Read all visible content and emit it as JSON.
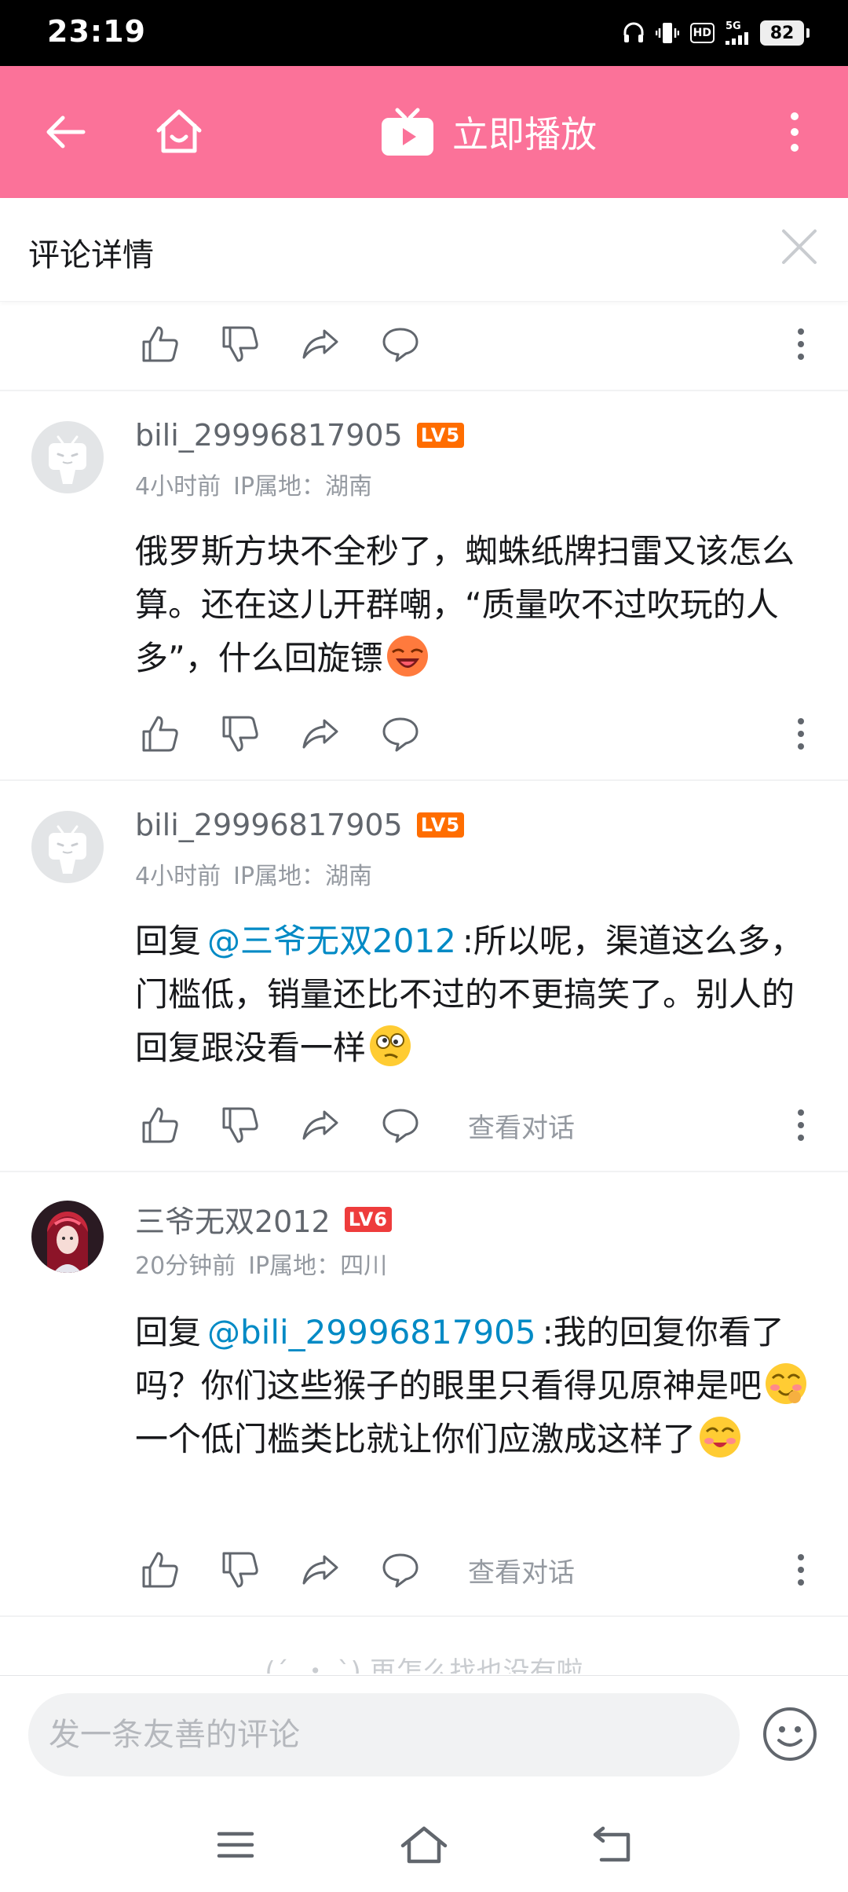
{
  "status_bar": {
    "time": "23:19",
    "battery": "82",
    "hd": "HD",
    "network": "5G"
  },
  "top_nav": {
    "play_label": "立即播放"
  },
  "detail_header": {
    "title": "评论详情"
  },
  "comments": [
    {
      "username": "bili_29996817905",
      "level": "LV5",
      "level_color": "#ff6d00",
      "time": "4小时前",
      "ip": "IP属地：湖南",
      "text": "俄罗斯方块不全秒了，蜘蛛纸牌扫雷又该怎么算。还在这儿开群嘲，“质量吹不过吹玩的人多”，什么回旋镖"
    },
    {
      "username": "bili_29996817905",
      "level": "LV5",
      "level_color": "#ff6d00",
      "time": "4小时前",
      "ip": "IP属地：湖南",
      "reply_prefix": "回复",
      "mention": "@三爷无双2012",
      "text": ":所以呢，渠道这么多，门槛低，销量还比不过的不更搞笑了。别人的回复跟没看一样",
      "view_conversation": "查看对话"
    },
    {
      "username": "三爷无双2012",
      "level": "LV6",
      "level_color": "#ee3c3c",
      "time": "20分钟前",
      "ip": "IP属地：四川",
      "reply_prefix": "回复",
      "mention": "@bili_29996817905",
      "text_a": ":我的回复你看了吗？你们这些猴子的眼里只看得见原神是吧",
      "text_b": "一个低门槛类比就让你们应激成这样了",
      "view_conversation": "查看对话"
    }
  ],
  "tail_hint": "(´_・ `) 再怎么找也没有啦",
  "composer": {
    "placeholder": "发一条友善的评论"
  },
  "colors": {
    "brand_pink": "#fb7299",
    "link_blue": "#008ac5",
    "text_gray": "#9499a0"
  }
}
